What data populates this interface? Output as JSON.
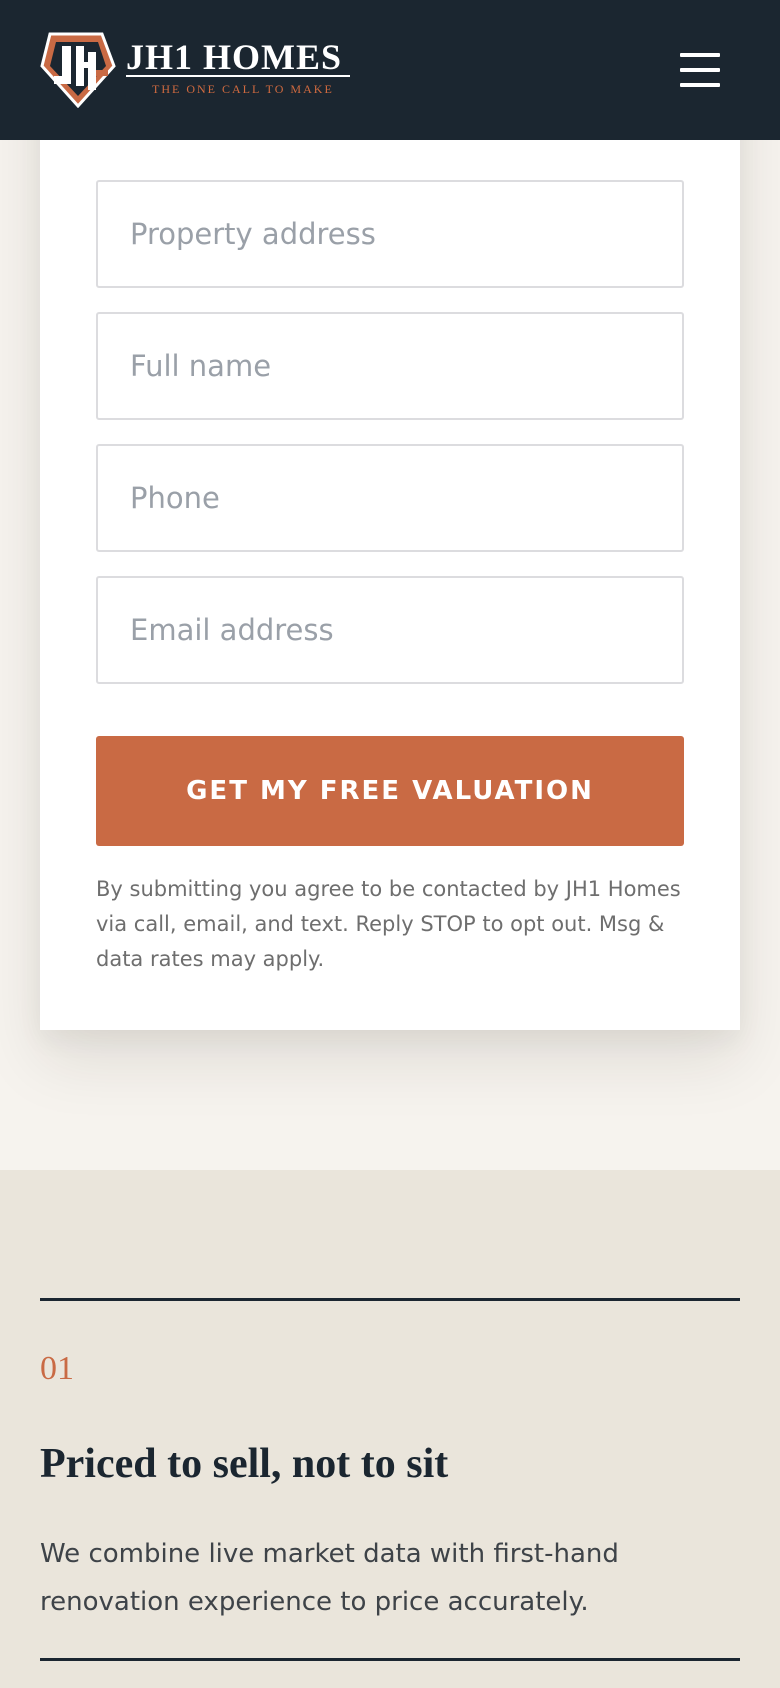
{
  "header": {
    "brand_name": "JH1 HOMES",
    "tagline": "THE ONE CALL TO MAKE",
    "logo_icon": "jh1-monogram-shield",
    "menu_icon": "hamburger-menu-icon"
  },
  "form": {
    "address_placeholder": "Property address",
    "name_placeholder": "Full name",
    "phone_placeholder": "Phone",
    "email_placeholder": "Email address",
    "submit_label": "GET MY FREE VALUATION",
    "consent_text": "By submitting you agree to be contacted by JH1 Homes via call, email, and text. Reply STOP to opt out. Msg & data rates may apply."
  },
  "steps": [
    {
      "number": "01",
      "title": "Priced to sell, not to sit",
      "body": "We combine live market data with first-hand renovation experience to price accurately."
    }
  ],
  "colors": {
    "header_bg": "#1B2630",
    "accent": "#C96A44",
    "section_bg": "#EAE5DB",
    "page_bg": "#F6F3EE"
  }
}
